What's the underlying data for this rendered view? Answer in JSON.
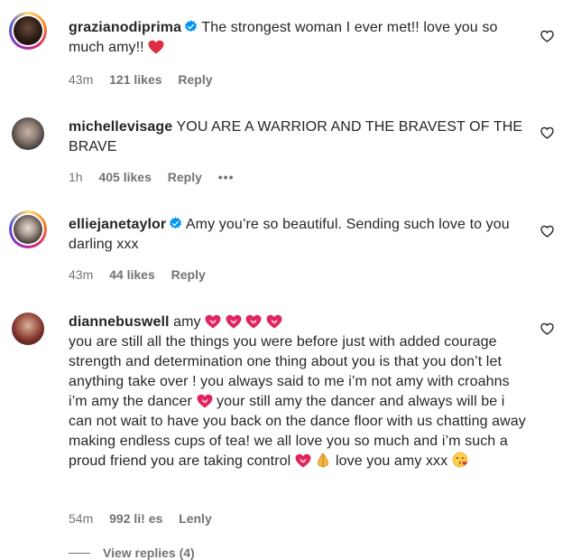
{
  "comments": [
    {
      "username": "grazianodiprima",
      "verified": true,
      "text": " The strongest woman I ever met!! love you so much amy!! ",
      "emojis_after": [
        "red-heart"
      ],
      "time": "43m",
      "likes": "121 likes",
      "reply": "Reply"
    },
    {
      "username": "michellevisage",
      "verified": false,
      "text": " YOU ARE A WARRIOR AND THE BRAVEST OF THE BRAVE",
      "time": "1h",
      "likes": "405 likes",
      "reply": "Reply",
      "more": "•••"
    },
    {
      "username": "elliejanetaylor",
      "verified": true,
      "text": " Amy you’re so beautiful. Sending such love to you darling xxx",
      "time": "43m",
      "likes": "44 likes",
      "reply": "Reply"
    },
    {
      "username": "diannebuswell",
      "verified": false,
      "text_part1": " amy ",
      "emojis_part1": [
        "heart-with-ribbon",
        "heart-with-ribbon",
        "heart-with-ribbon",
        "heart-with-ribbon"
      ],
      "text_part2": "you are still all the things you were before just with added courage strength and determination one thing about you is that you don’t let anything take over ! you always said to me i’m not amy with croahns i’m amy the dancer ",
      "text_part3": " your still amy the dancer and always will be i can not wait to have you back on the dance floor with us chatting away making endless cups of tea! we all love you so much and i’m such a proud friend you are taking control ",
      "text_part4": " love you amy xxx ",
      "time": "54m",
      "likes": "992 li! es",
      "reply": "Lenly"
    }
  ],
  "view_replies": "View replies (4)",
  "colors": {
    "text": "#262626",
    "meta": "#737373",
    "verified": "#0095f6",
    "heart": "#e0245e"
  },
  "icons": [
    "like-heart-outline-icon",
    "verified-badge-icon",
    "more-options-icon"
  ]
}
